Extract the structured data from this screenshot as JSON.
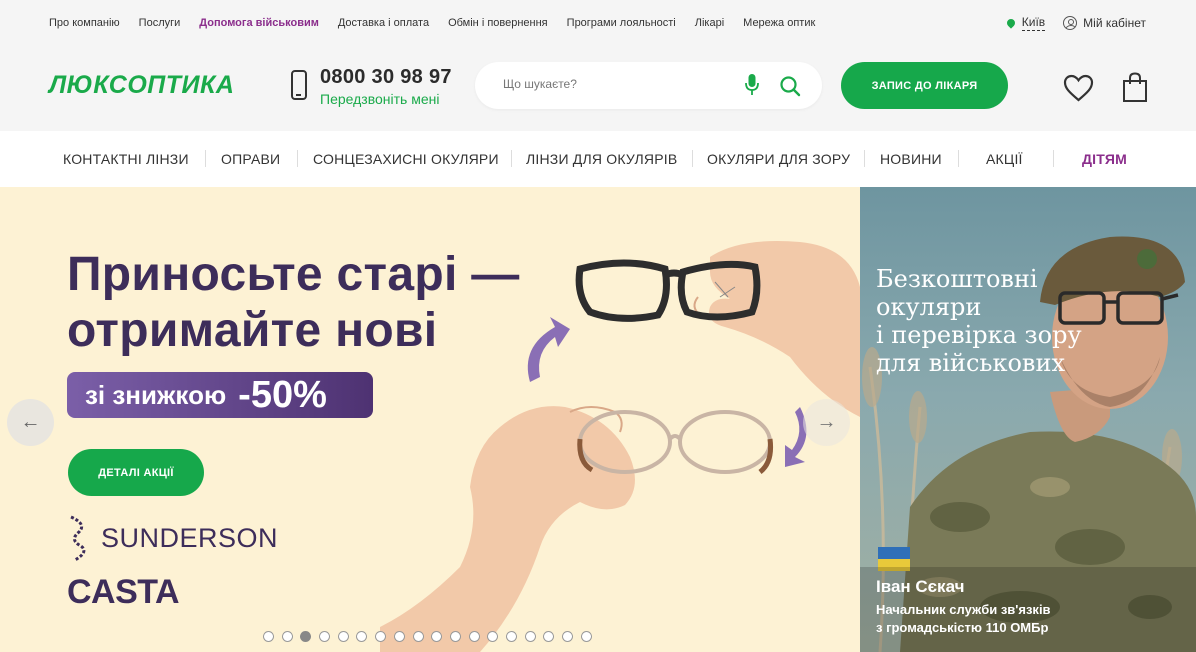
{
  "topbar": {
    "links": [
      "Про компанію",
      "Послуги",
      "Допомога військовим",
      "Доставка і оплата",
      "Обмін і повернення",
      "Програми лояльності",
      "Лікарі",
      "Мережа оптик"
    ],
    "city": "Київ",
    "cabinet": "Мій кабінет"
  },
  "header": {
    "logo": "ЛЮКСОПТИКА",
    "phone": "0800 30 98 97",
    "callback": "Передзвоніть мені",
    "search_placeholder": "Що шукаєте?",
    "doctor_button": "ЗАПИС ДО ЛІКАРЯ"
  },
  "nav": {
    "items": [
      "КОНТАКТНІ ЛІНЗИ",
      "ОПРАВИ",
      "СОНЦЕЗАХИСНІ ОКУЛЯРИ",
      "ЛІНЗИ ДЛЯ ОКУЛЯРІВ",
      "ОКУЛЯРИ ДЛЯ ЗОРУ",
      "НОВИНИ",
      "АКЦІЇ",
      "ДІТЯМ"
    ]
  },
  "hero": {
    "title_line1": "Приносьте старі —",
    "title_line2": "отримайте нові",
    "discount_text": "зі знижкою",
    "discount_value": "-50%",
    "details_button": "ДЕТАЛІ АКЦІЇ",
    "brand1": "SUNDERSON",
    "brand2": "CASTA",
    "slides_total": 18,
    "active_slide": 3
  },
  "side_banner": {
    "title_lines": [
      "Безкоштовні",
      "окуляри",
      "і перевірка зору",
      "для військових"
    ],
    "person_name": "Іван Сєкач",
    "role_line1": "Начальник служби зв'язків",
    "role_line2": "з громадськістю 110 ОМБр"
  },
  "colors": {
    "brand_green": "#16a84b",
    "accent_purple": "#8b2e8c",
    "hero_text": "#3d2d5a",
    "hero_bg": "#fdf2d4"
  }
}
